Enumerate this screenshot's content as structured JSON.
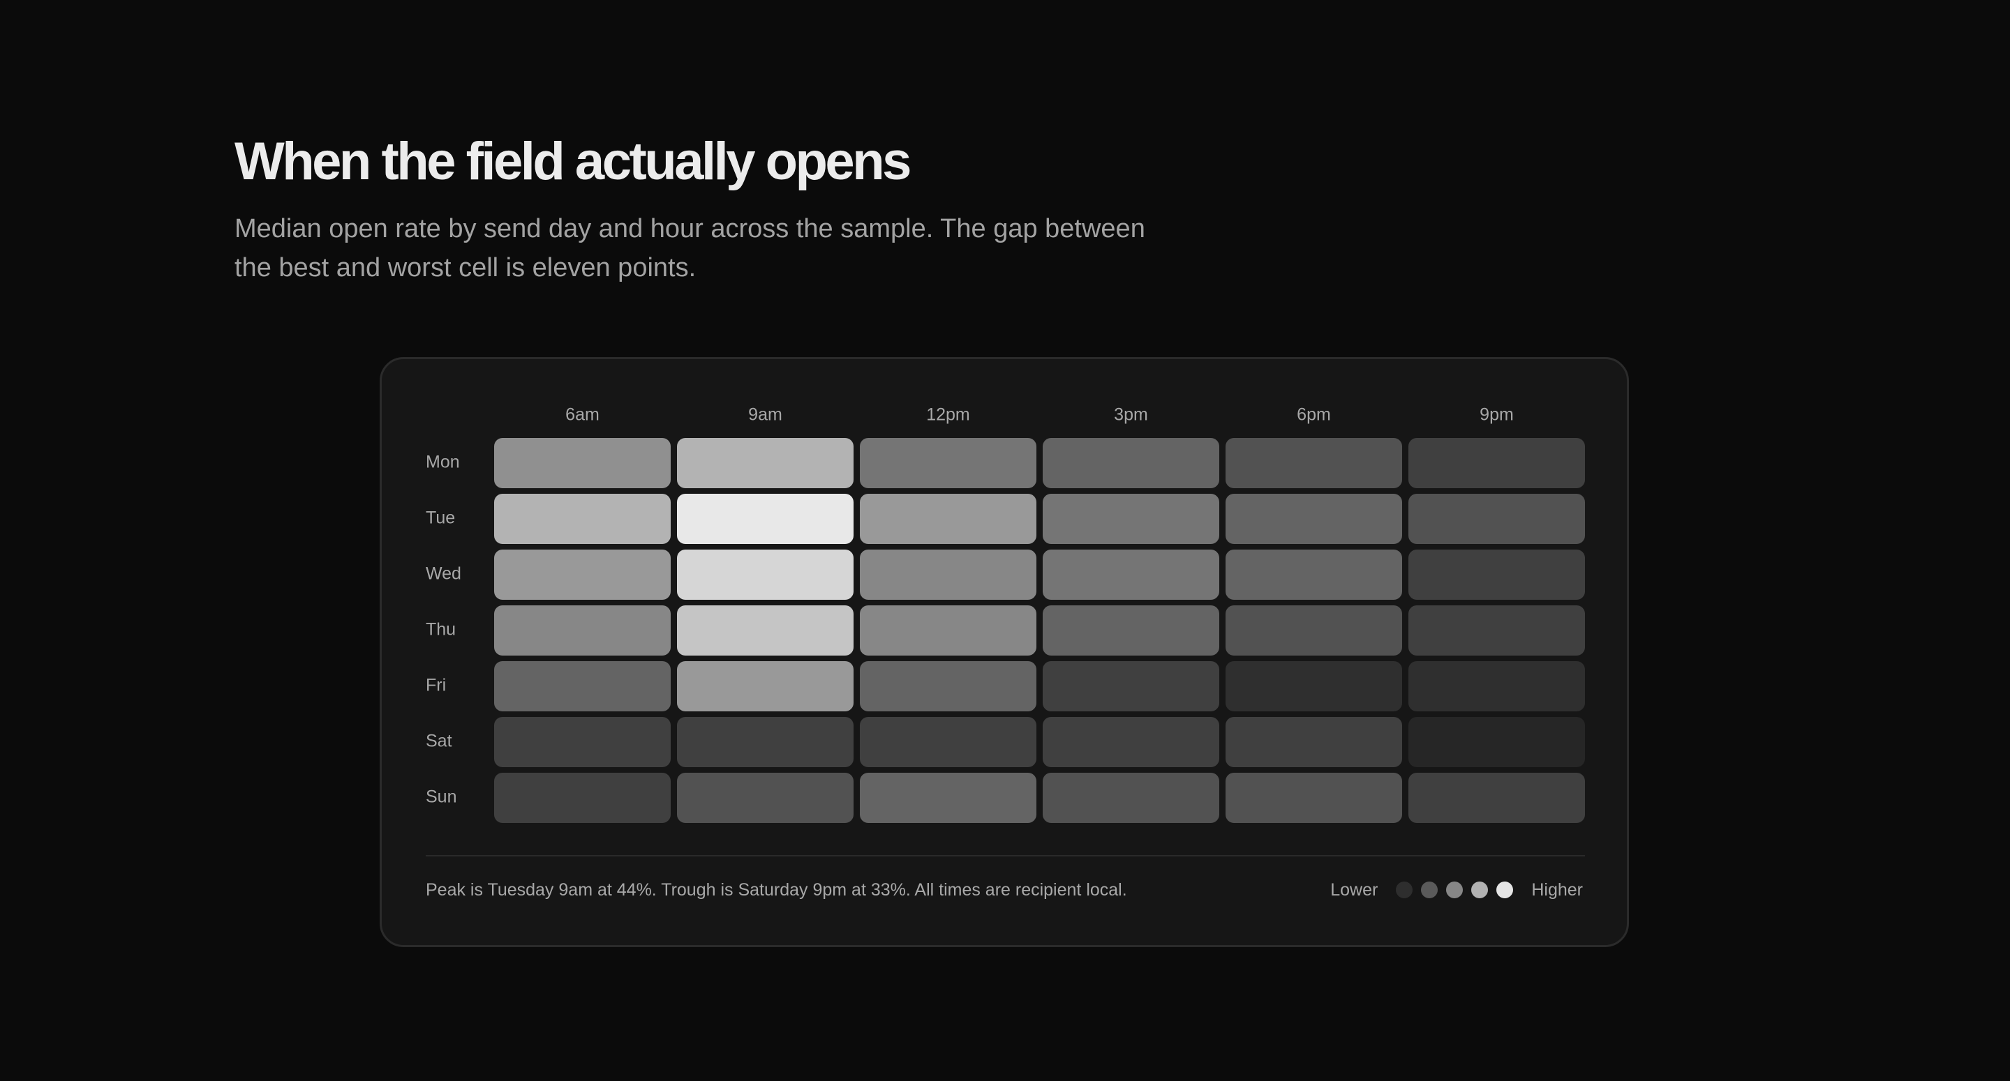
{
  "header": {
    "title": "When the field actually opens",
    "subtitle": "Median open rate by send day and hour across the sample. The gap between the best and worst cell is eleven points."
  },
  "chart_data": {
    "type": "heatmap",
    "x": [
      "6am",
      "9am",
      "12pm",
      "3pm",
      "6pm",
      "9pm"
    ],
    "y": [
      "Mon",
      "Tue",
      "Wed",
      "Thu",
      "Fri",
      "Sat",
      "Sun"
    ],
    "values": [
      [
        39,
        41,
        37.5,
        36.5,
        35.5,
        34.5
      ],
      [
        41,
        44,
        39.5,
        37.5,
        36.5,
        35.5
      ],
      [
        39.5,
        43,
        38.5,
        37.5,
        36.5,
        34.5
      ],
      [
        38.5,
        42,
        38.5,
        36.5,
        35.5,
        34.5
      ],
      [
        36.5,
        39.5,
        36.5,
        34.5,
        33.5,
        33.5
      ],
      [
        34.5,
        34.5,
        34.5,
        34.5,
        34.5,
        33
      ],
      [
        34.5,
        35.5,
        36.5,
        35.5,
        35.5,
        34.5
      ]
    ],
    "value_range": [
      33,
      44
    ],
    "unit": "%",
    "legend": {
      "low_label": "Lower",
      "high_label": "Higher",
      "position": "bottom-right",
      "swatches": [
        "#2e2e2e",
        "#5a5a5a",
        "#878787",
        "#b2b2b2",
        "#e6e6e6"
      ]
    },
    "color_scale": [
      "#262626",
      "#e8e8e8"
    ],
    "note": "Peak is Tuesday 9am at 44%. Trough is Saturday 9pm at 33%. All times are recipient local."
  }
}
